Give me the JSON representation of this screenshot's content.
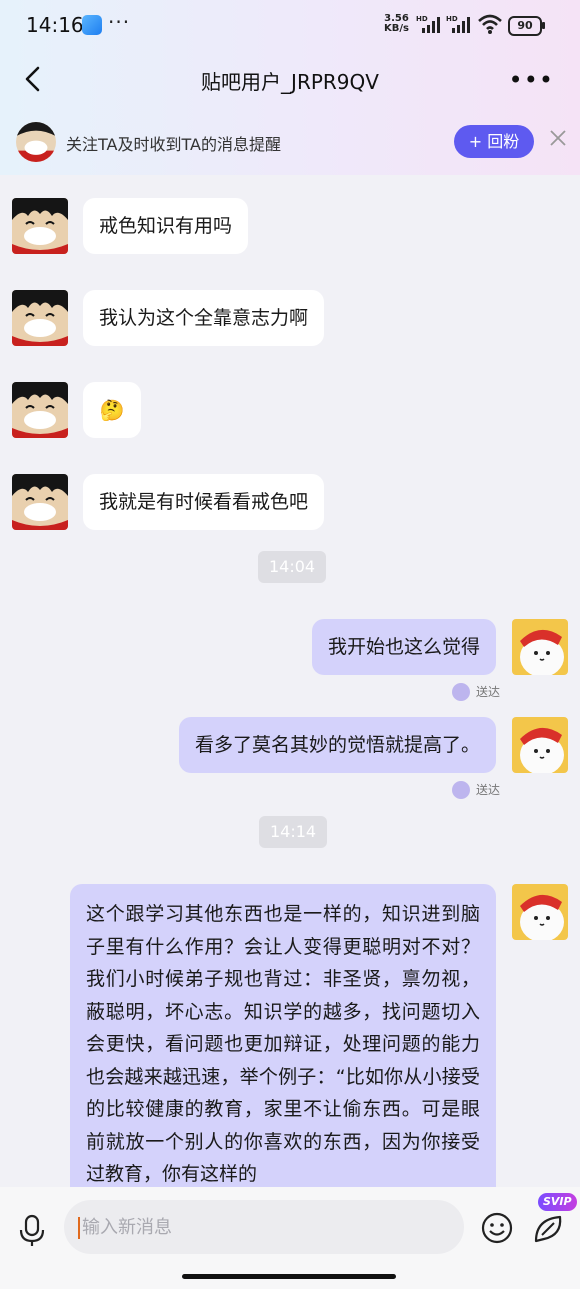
{
  "status_bar": {
    "time": "14:16",
    "dots": "···",
    "net_speed_value": "3.56",
    "net_speed_unit": "KB/s",
    "battery": "90"
  },
  "nav": {
    "title": "贴吧用户_JRPR9QV"
  },
  "follow_bar": {
    "text": "关注TA及时收到TA的消息提醒",
    "button_label": "+ 回粉"
  },
  "messages": {
    "m1": "戒色知识有用吗",
    "m2": "我认为这个全靠意志力啊",
    "m3": "🤔",
    "m4": "我就是有时候看看戒色吧",
    "time1": "14:04",
    "m5": "我开始也这么觉得",
    "m5_status": "送达",
    "m6": "看多了莫名其妙的觉悟就提高了。",
    "m6_status": "送达",
    "time2": "14:14",
    "m7": "这个跟学习其他东西也是一样的，知识进到脑子里有什么作用？会让人变得更聪明对不对？我们小时候弟子规也背过：非圣贤，禀勿视，蔽聪明，坏心志。知识学的越多，找问题切入会更快，看问题也更加辩证，处理问题的能力也会越来越迅速，举个例子：“比如你从小接受的比较健康的教育，家里不让偷东西。可是眼前就放一个别人的你喜欢的东西，因为你接受过教育，你有这样的"
  },
  "input_bar": {
    "placeholder": "输入新消息",
    "svip_badge": "SVIP"
  }
}
